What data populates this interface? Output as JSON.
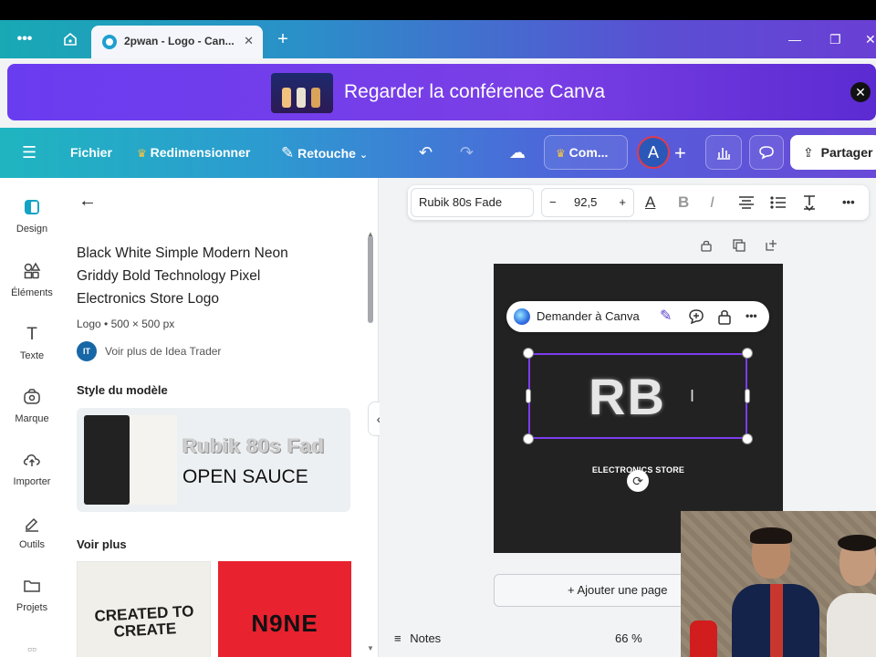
{
  "browser": {
    "menu_icon": "more-horizontal-icon",
    "home_icon": "home-icon",
    "tab_title": "2pwan - Logo - Can...",
    "tab_close": "✕",
    "new_tab": "+",
    "minimize": "—",
    "maximize": "❐",
    "close": "✕"
  },
  "banner": {
    "text": "Regarder la conférence Canva",
    "close": "✕"
  },
  "toolbar": {
    "menu_icon": "hamburger-icon",
    "file": "Fichier",
    "resize": "Redimensionner",
    "retouch": "Retouche",
    "undo_icon": "undo-icon",
    "redo_icon": "redo-icon",
    "cloud_icon": "cloud-check-icon",
    "comment_pill": "Com...",
    "avatar_letter": "A",
    "add": "+",
    "share": "Partager"
  },
  "rail": {
    "items": [
      {
        "label": "Design",
        "icon": "design-icon"
      },
      {
        "label": "Éléments",
        "icon": "elements-icon"
      },
      {
        "label": "Texte",
        "icon": "text-icon"
      },
      {
        "label": "Marque",
        "icon": "brand-icon"
      },
      {
        "label": "Importer",
        "icon": "upload-icon"
      },
      {
        "label": "Outils",
        "icon": "tools-icon"
      },
      {
        "label": "Projets",
        "icon": "folder-icon"
      }
    ]
  },
  "panel": {
    "title": "Black White Simple Modern Neon Griddy Bold Technology Pixel Electronics Store Logo",
    "meta": "Logo • 500 × 500 px",
    "author_initials": "IT",
    "author_link": "Voir plus de Idea Trader",
    "style_heading": "Style du modèle",
    "style_font1": "Rubik 80s Fad",
    "style_font2": "OPEN SAUCE",
    "more_heading": "Voir plus",
    "thumb1_text": "CREATED TO CREATE",
    "thumb2_text": "N9NE"
  },
  "format_bar": {
    "font": "Rubik 80s Fade",
    "minus": "−",
    "size": "92,5",
    "plus": "+",
    "text_color": "A",
    "bold": "B",
    "italic": "I",
    "more": "•••"
  },
  "canvas": {
    "ask_label": "Demander à Canva",
    "logo_text": "RB",
    "store_text": "ELECTRONICS STORE",
    "add_page": "+ Ajouter une page"
  },
  "bottom": {
    "notes": "Notes",
    "zoom": "66 %"
  },
  "colors": {
    "accent": "#7d3cf0",
    "toolbar_start": "#1fb5c0",
    "toolbar_end": "#6a48d8",
    "design_bg": "#222222"
  }
}
